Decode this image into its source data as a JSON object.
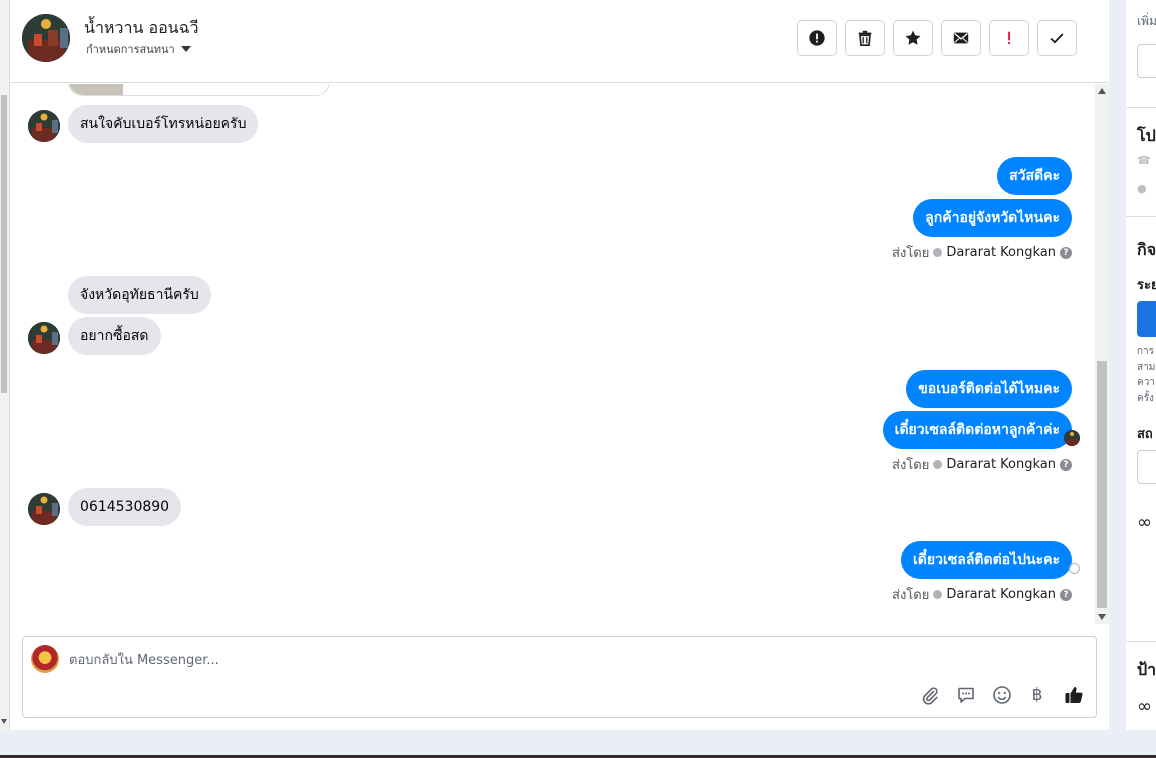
{
  "header": {
    "contact_name": "น้ำหวาน ออนฉวี",
    "assign_label": "กำหนดการสนทนา",
    "actions": [
      {
        "name": "mark-spam-button",
        "icon": "alert-circle-icon"
      },
      {
        "name": "delete-button",
        "icon": "trash-icon"
      },
      {
        "name": "star-button",
        "icon": "star-icon"
      },
      {
        "name": "mark-unread-button",
        "icon": "envelope-icon"
      },
      {
        "name": "follow-up-button",
        "icon": "exclamation-icon"
      },
      {
        "name": "mark-done-button",
        "icon": "check-icon"
      }
    ]
  },
  "messages": [
    {
      "side": "in",
      "text": "สนใจคับเบอร์โทรหน่อยครับ"
    },
    {
      "side": "out",
      "text": "สวัสดีคะ"
    },
    {
      "side": "out",
      "text": "ลูกค้าอยู่จังหวัดไหนคะ"
    },
    {
      "side": "in",
      "text": "จังหวัดอุทัยธานีครับ"
    },
    {
      "side": "in",
      "text": "อยากซื้อสด"
    },
    {
      "side": "out",
      "text": "ขอเบอร์ติดต่อได้ไหมคะ"
    },
    {
      "side": "out",
      "text": "เดี๋ยวเซลล์ติดต่อหาลูกค้าค่ะ"
    },
    {
      "side": "in",
      "text": "0614530890"
    },
    {
      "side": "out",
      "text": "เดี๋ยวเซลล์ติดต่อไปนะคะ"
    }
  ],
  "sent_by": {
    "prefix": "ส่งโดย",
    "name": "Dararat Kongkan"
  },
  "composer": {
    "placeholder": "ตอบกลับใน Messenger...",
    "tools": [
      "paperclip-icon",
      "chat-bubble-icon",
      "smiley-icon",
      "baht-icon",
      "thumbs-up-icon"
    ],
    "baht_symbol": "฿"
  },
  "right_panel": {
    "top_label": "เพิ่ม",
    "section_profile": "โป",
    "section_activity": "กิจ",
    "activity_sub": "ระย",
    "note_lines": [
      "การ",
      "สาม",
      "ควา",
      "ครั้ง"
    ],
    "section_status": "สถ",
    "section_labels": "ป้า"
  },
  "colors": {
    "outgoing_bubble": "#0084ff",
    "incoming_bubble": "#e4e6eb",
    "accent_blue": "#1b74e4",
    "follow_up_red": "#e41e3f"
  }
}
